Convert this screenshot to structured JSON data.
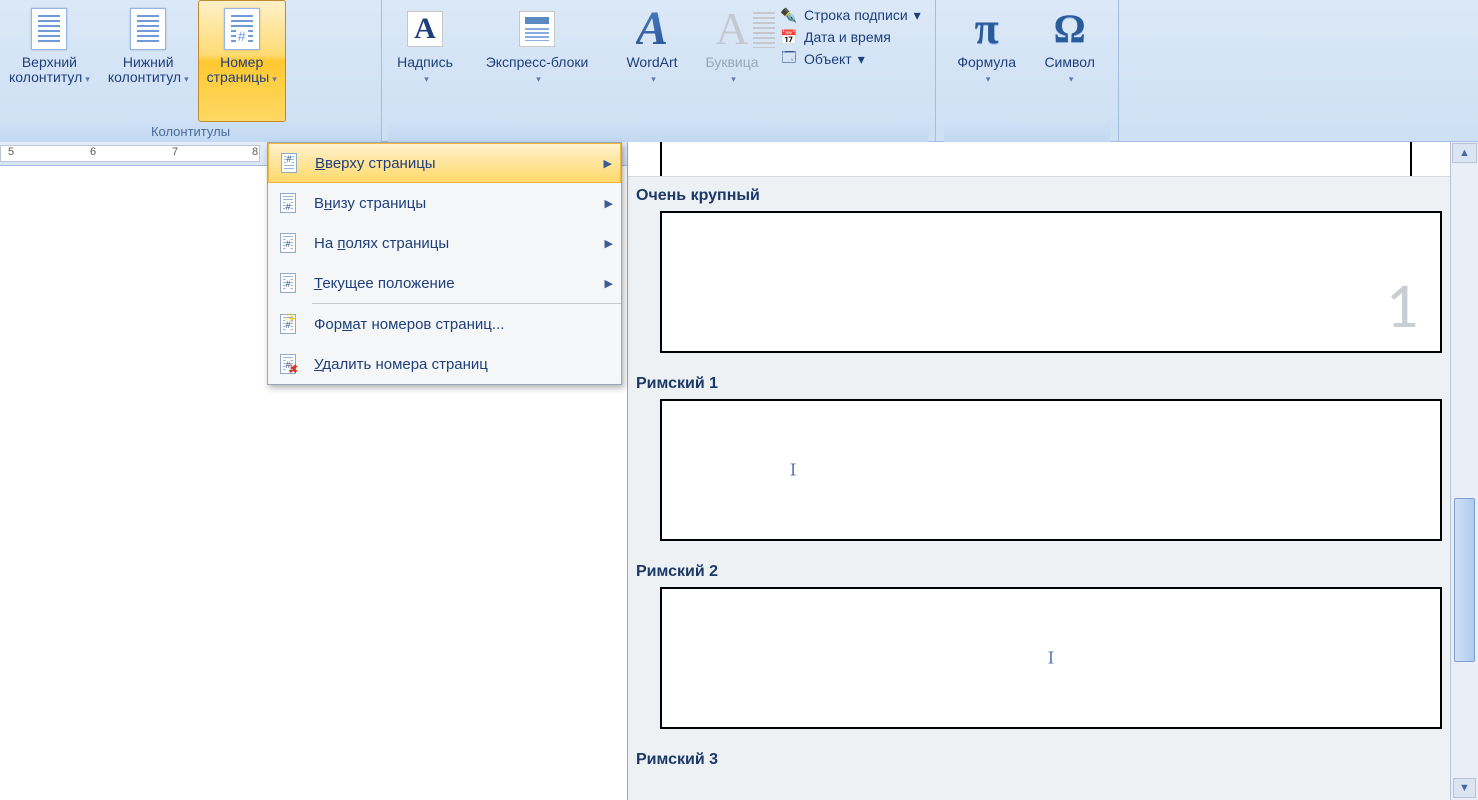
{
  "ribbon": {
    "group_headers": {
      "label": "Колонтитулы"
    },
    "top_header": {
      "label": "Верхний\nколонтитул"
    },
    "bottom_header": {
      "label": "Нижний\nколонтитул"
    },
    "page_number": {
      "label": "Номер\nстраницы"
    },
    "textbox": {
      "label": "Надпись"
    },
    "quick_parts": {
      "label": "Экспресс-блоки"
    },
    "wordart": {
      "label": "WordArt"
    },
    "drop_cap": {
      "label": "Буквица"
    },
    "signature_line": {
      "label": "Строка подписи"
    },
    "date_time": {
      "label": "Дата и время"
    },
    "object": {
      "label": "Объект"
    },
    "equation": {
      "label": "Формула"
    },
    "symbol": {
      "label": "Символ"
    }
  },
  "ruler_ticks": [
    "5",
    "6",
    "7",
    "8"
  ],
  "page_number_menu": {
    "top_of_page": "Вверху страницы",
    "bottom_of_page": "Внизу страницы",
    "page_margins": "На полях страницы",
    "current_position": "Текущее положение",
    "format": "Формат номеров страниц...",
    "remove": "Удалить номера страниц"
  },
  "gallery": {
    "sections": [
      {
        "title": "Очень крупный",
        "items": [
          {
            "style": "large_number_right",
            "value": "1"
          }
        ]
      },
      {
        "title": "Римский 1",
        "items": [
          {
            "style": "roman_left",
            "value": "I"
          }
        ]
      },
      {
        "title": "Римский 2",
        "items": [
          {
            "style": "roman_center",
            "value": "I"
          }
        ]
      },
      {
        "title": "Римский 3",
        "items": []
      }
    ]
  }
}
